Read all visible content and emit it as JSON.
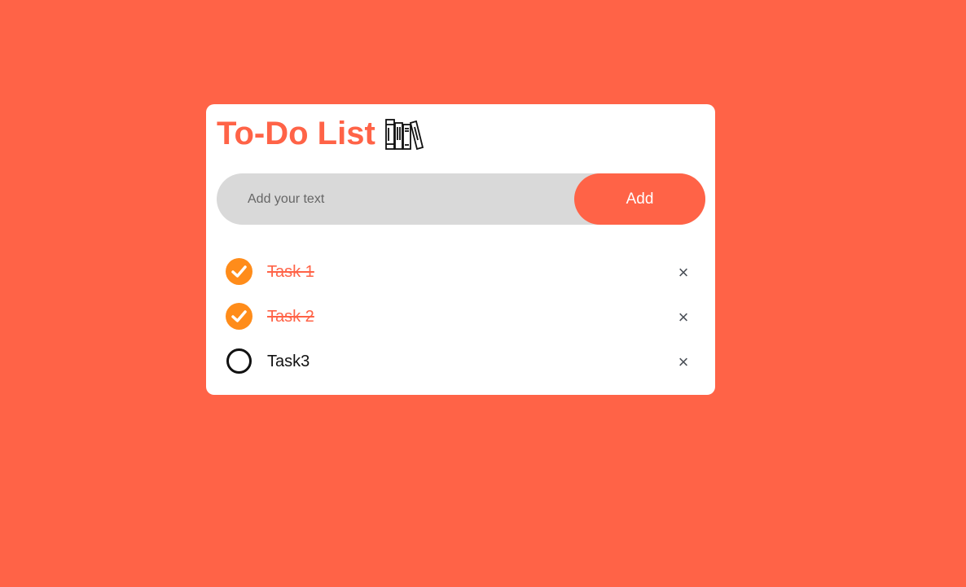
{
  "app": {
    "title": "To-Do List",
    "title_icon": "books-icon"
  },
  "input": {
    "placeholder": "Add your text",
    "value": "",
    "add_label": "Add"
  },
  "colors": {
    "background": "#ff6347",
    "accent": "#ff6347",
    "check": "#ff8c1a"
  },
  "tasks": [
    {
      "label": "Task 1",
      "done": true,
      "remove_glyph": "×"
    },
    {
      "label": "Task 2",
      "done": true,
      "remove_glyph": "×"
    },
    {
      "label": "Task3",
      "done": false,
      "remove_glyph": "×"
    }
  ]
}
